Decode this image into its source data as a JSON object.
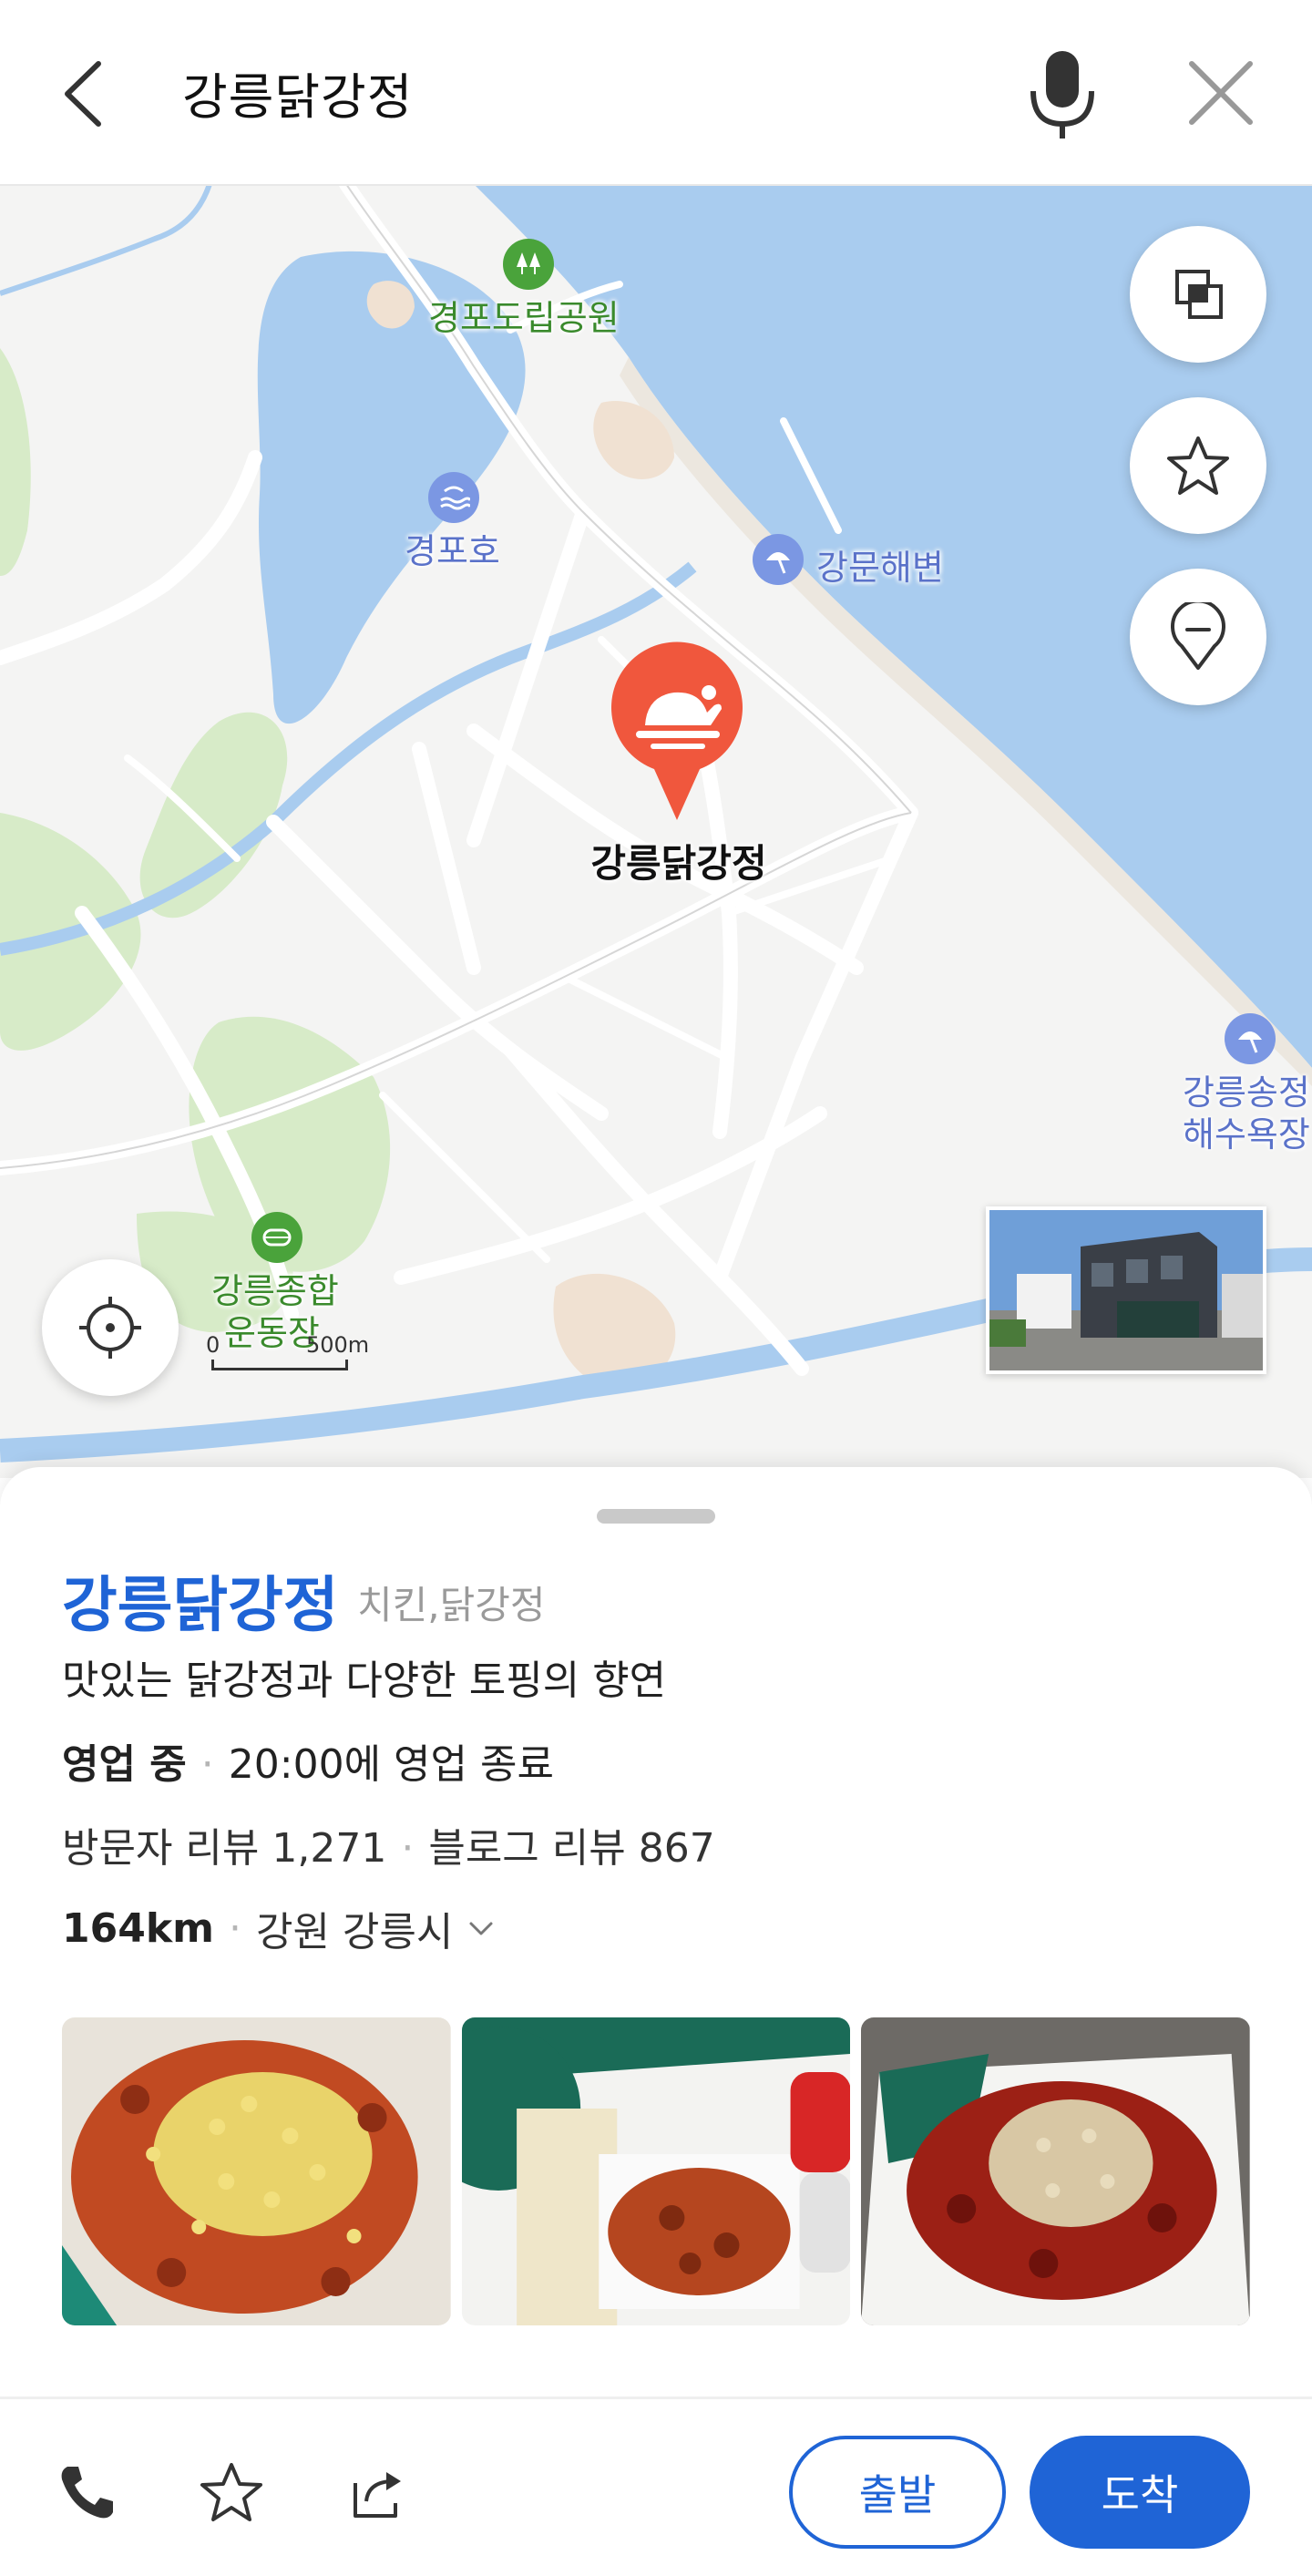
{
  "search": {
    "query": "강릉닭강정"
  },
  "map": {
    "pois": {
      "park": "경포도립공원",
      "lake": "경포호",
      "beach1": "강문해변",
      "beach2_line1": "강릉송정",
      "beach2_line2": "해수욕장",
      "stadium_line1": "강릉종합",
      "stadium_line2": "운동장"
    },
    "pin_label": "강릉닭강정",
    "scale": {
      "start": "0",
      "end": "500m"
    }
  },
  "place": {
    "name": "강릉닭강정",
    "category": "치킨,닭강정",
    "description": "맛있는 닭강정과 다양한 토핑의 향연",
    "status": "영업 중",
    "hours_text": "20:00에 영업 종료",
    "visitor_reviews": "방문자 리뷰 1,271",
    "blog_reviews": "블로그 리뷰 867",
    "distance": "164km",
    "address": "강원 강릉시"
  },
  "actions": {
    "depart": "출발",
    "arrive": "도착"
  },
  "colors": {
    "accent": "#1f64d6",
    "pin": "#f0573d",
    "water": "#a9ccef",
    "park": "#d7ebc8"
  }
}
